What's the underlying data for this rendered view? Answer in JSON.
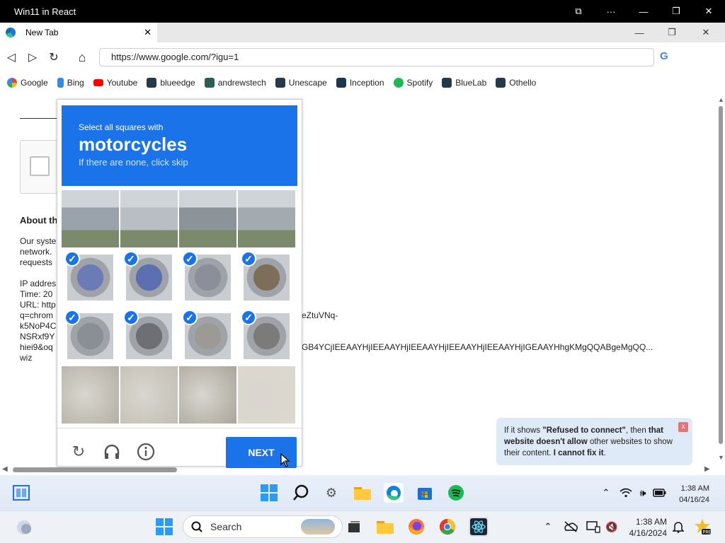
{
  "window": {
    "title": "Win11 in React"
  },
  "tab": {
    "title": "New Tab",
    "close": "✕"
  },
  "address": {
    "url": "https://www.google.com/?igu=1"
  },
  "bookmarks": [
    "Google",
    "Bing",
    "Youtube",
    "blueedge",
    "andrewstech",
    "Unescape",
    "Inception",
    "Spotify",
    "BlueLab",
    "Othello"
  ],
  "page": {
    "about": "About th",
    "lines": [
      "Our syste",
      "network.",
      "requests"
    ],
    "ip": "IP addres",
    "time": "Time: 20",
    "url": "URL: http",
    "q1": "q=chrom",
    "q2": "k5NoP4C",
    "q3": "NSRxf9Y",
    "q4": "hiei9&oq",
    "q5": "wiz",
    "frag1": "eZtuVNq-",
    "frag2": "GB4YCjIEEAAYHjIEEAAYHjIEEAAYHjIEEAAYHjIEEAAYHjIGEAAYHhgKMgQQABgeMgQQ..."
  },
  "captcha": {
    "instruction": "Select all squares with",
    "target": "motorcycles",
    "hint": "If there are none, click skip",
    "next": "NEXT",
    "tiles": [
      {
        "row": 0,
        "col": 0,
        "selected": false
      },
      {
        "row": 0,
        "col": 1,
        "selected": false
      },
      {
        "row": 0,
        "col": 2,
        "selected": false
      },
      {
        "row": 0,
        "col": 3,
        "selected": false
      },
      {
        "row": 1,
        "col": 0,
        "selected": true
      },
      {
        "row": 1,
        "col": 1,
        "selected": true
      },
      {
        "row": 1,
        "col": 2,
        "selected": true
      },
      {
        "row": 1,
        "col": 3,
        "selected": true
      },
      {
        "row": 2,
        "col": 0,
        "selected": true
      },
      {
        "row": 2,
        "col": 1,
        "selected": true
      },
      {
        "row": 2,
        "col": 2,
        "selected": true
      },
      {
        "row": 2,
        "col": 3,
        "selected": true
      },
      {
        "row": 3,
        "col": 0,
        "selected": false
      },
      {
        "row": 3,
        "col": 1,
        "selected": false
      },
      {
        "row": 3,
        "col": 2,
        "selected": false
      },
      {
        "row": 3,
        "col": 3,
        "selected": false
      }
    ]
  },
  "toast": {
    "p1": "If it shows ",
    "b1": "\"Refused to connect\"",
    "p2": ", then ",
    "b2": "that website doesn't allow",
    "p3": " other websites to show their content. ",
    "b3": "I cannot fix it",
    "p4": ".",
    "close": "x"
  },
  "taskbar_inner": {
    "time": "1:38 AM",
    "date": "04/16/24"
  },
  "taskbar_outer": {
    "search": "Search",
    "time": "1:38 AM",
    "date": "4/16/2024"
  },
  "colors": {
    "accent": "#1a73e8",
    "titlebar": "#000000"
  }
}
